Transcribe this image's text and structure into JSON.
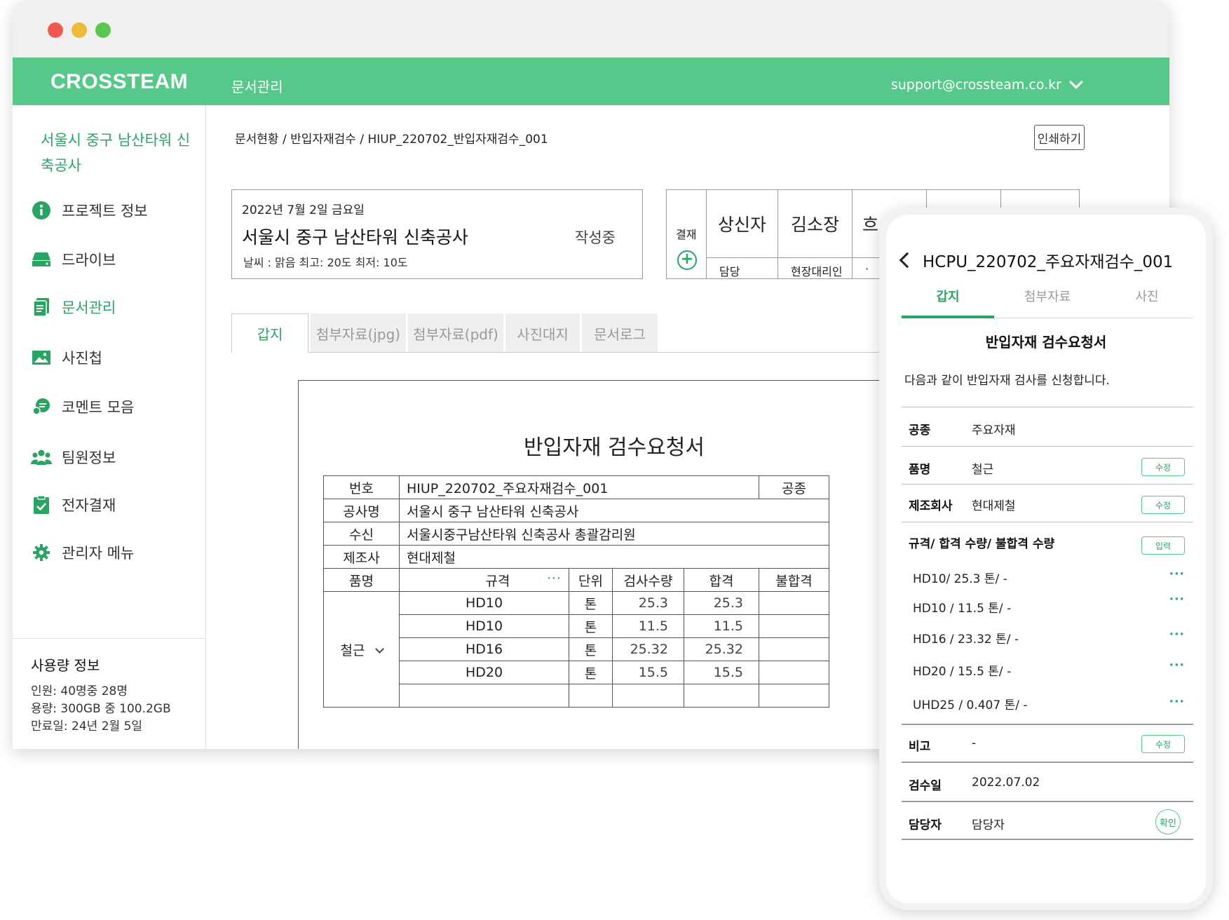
{
  "app": {
    "logo": "CROSSTEAM",
    "section_title": "문서관리",
    "account_email": "support@crossteam.co.kr"
  },
  "sidebar": {
    "project_name": "서울시 중구 남산타워 신축공사",
    "items": [
      {
        "label": "프로젝트 정보",
        "icon": "info-icon"
      },
      {
        "label": "드라이브",
        "icon": "drive-icon"
      },
      {
        "label": "문서관리",
        "icon": "document-icon",
        "active": true
      },
      {
        "label": "사진첩",
        "icon": "photo-icon"
      },
      {
        "label": "코멘트 모음",
        "icon": "comment-icon"
      },
      {
        "label": "팀원정보",
        "icon": "team-icon"
      },
      {
        "label": "전자결재",
        "icon": "approval-icon"
      },
      {
        "label": "관리자 메뉴",
        "icon": "gear-icon"
      }
    ],
    "usage": {
      "title": "사용량 정보",
      "members": "인원: 40명중 28명",
      "storage": "용량: 300GB 중 100.2GB",
      "expiry": "만료일: 24년 2월 5일"
    }
  },
  "main": {
    "breadcrumb": "문서현황 / 반입자재검수 / HIUP_220702_반입자재검수_001",
    "print_label": "인쇄하기",
    "info": {
      "date": "2022년 7월 2일 금요일",
      "title": "서울시 중구 남산타워 신축공사",
      "status": "작성중",
      "weather": "날씨 : 맑음  최고: 20도  최저: 10도"
    },
    "approval": {
      "label": "결재",
      "columns": [
        {
          "title": "상신자",
          "sub": "담당"
        },
        {
          "title": "김소장",
          "sub": "현장대리인"
        },
        {
          "title": "흐",
          "sub": "·"
        }
      ]
    },
    "tabs": [
      "갑지",
      "첨부자료(jpg)",
      "첨부자료(pdf)",
      "사진대지",
      "문서로그"
    ],
    "doc": {
      "title": "반입자재 검수요청서",
      "no_label": "번호",
      "no_value": "HIUP_220702_주요자재검수_001",
      "type_label": "공종",
      "site_label": "공사명",
      "site_value": "서울시 중구 남산타워 신축공사",
      "recv_label": "수신",
      "recv_value": "서울시중구남산타워 신축공사 총괄감리원",
      "maker_label": "제조사",
      "maker_value": "현대제철",
      "headers": {
        "item": "품명",
        "spec": "규격",
        "more": "···",
        "unit": "단위",
        "qty": "검사수량",
        "pass": "합격",
        "fail": "불합격"
      },
      "item_name": "철근",
      "rows": [
        {
          "spec": "HD10",
          "unit": "톤",
          "qty": "25.3",
          "pass": "25.3"
        },
        {
          "spec": "HD10",
          "unit": "톤",
          "qty": "11.5",
          "pass": "11.5"
        },
        {
          "spec": "HD16",
          "unit": "톤",
          "qty": "25.32",
          "pass": "25.32"
        },
        {
          "spec": "HD20",
          "unit": "톤",
          "qty": "15.5",
          "pass": "15.5"
        }
      ]
    }
  },
  "mobile": {
    "title": "HCPU_220702_주요자재검수_001",
    "tabs": [
      "갑지",
      "첨부자료",
      "사진"
    ],
    "doc_title": "반입자재 검수요청서",
    "intro": "다음과 같이 반입자재 검사를 신청합니다.",
    "fields": {
      "type": {
        "label": "공종",
        "value": "주요자재"
      },
      "item": {
        "label": "품명",
        "value": "철근",
        "button": "수정"
      },
      "maker": {
        "label": "제조회사",
        "value": "현대제철",
        "button": "수정"
      },
      "spec": {
        "label": "규격/ 합격 수량/ 불합격 수량",
        "button": "입력"
      },
      "note": {
        "label": "비고",
        "value": "-",
        "button": "수정"
      },
      "date": {
        "label": "검수일",
        "value": "2022.07.02"
      },
      "manager": {
        "label": "담당자",
        "value": "담당자",
        "button": "확인"
      }
    },
    "spec_items": [
      "HD10/ 25.3 톤/ -",
      "HD10 / 11.5 톤/ -",
      "HD16 / 23.32 톤/ -",
      "HD20 / 15.5 톤/ -",
      "UHD25 / 0.407 톤/ -"
    ],
    "more": "···"
  }
}
